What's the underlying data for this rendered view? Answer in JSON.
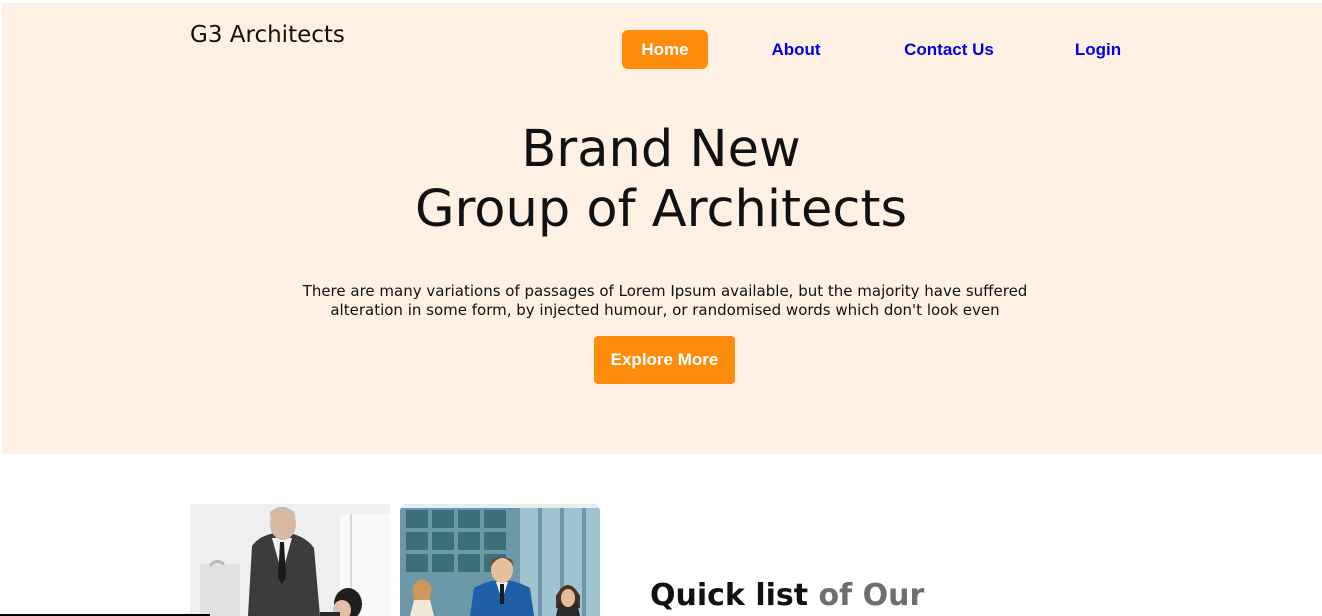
{
  "header": {
    "brand": "G3 Architects",
    "nav": [
      {
        "label": "Home",
        "active": true
      },
      {
        "label": "About"
      },
      {
        "label": "Contact Us"
      },
      {
        "label": "Login"
      }
    ]
  },
  "hero": {
    "title_line1": "Brand New",
    "title_line2": "Group of Architects",
    "description_line1": "There are many variations of passages of Lorem Ipsum available, but the majority have suffered",
    "description_line2": "alteration in some form, by injected humour, or randomised words which don't look even",
    "cta_label": "Explore More"
  },
  "quick_list": {
    "title_strong": "Quick list",
    "title_muted": "of Our"
  },
  "colors": {
    "hero_background": "#fef1e4",
    "accent": "#fd8c0c",
    "nav_link": "#0000e0",
    "muted_text": "#6e6e6e"
  }
}
